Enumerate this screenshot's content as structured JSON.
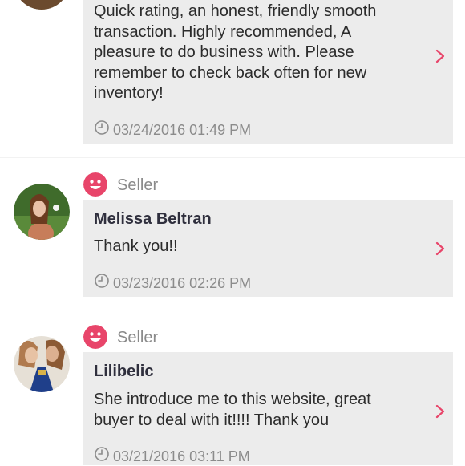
{
  "reviews": [
    {
      "text": "Quick rating, an honest, friendly smooth transaction. Highly recommended, A pleasure to do business with. Please remember to check back often for new inventory!",
      "date": "03/24/2016 01:49 PM"
    },
    {
      "role": "Seller",
      "name": "Melissa Beltran",
      "text": "Thank you!!",
      "date": "03/23/2016 02:26 PM"
    },
    {
      "role": "Seller",
      "name": "Lilibelic",
      "text": "She introduce me to this website, great buyer to deal with it!!!! Thank you",
      "date": "03/21/2016 03:11 PM"
    }
  ],
  "colors": {
    "accent": "#e8456a",
    "card_bg": "#ececec",
    "muted_text": "#8b8b8b"
  },
  "icons": {
    "role_badge": "smiley-face-icon",
    "date": "clock-icon",
    "open": "chevron-right-icon"
  }
}
